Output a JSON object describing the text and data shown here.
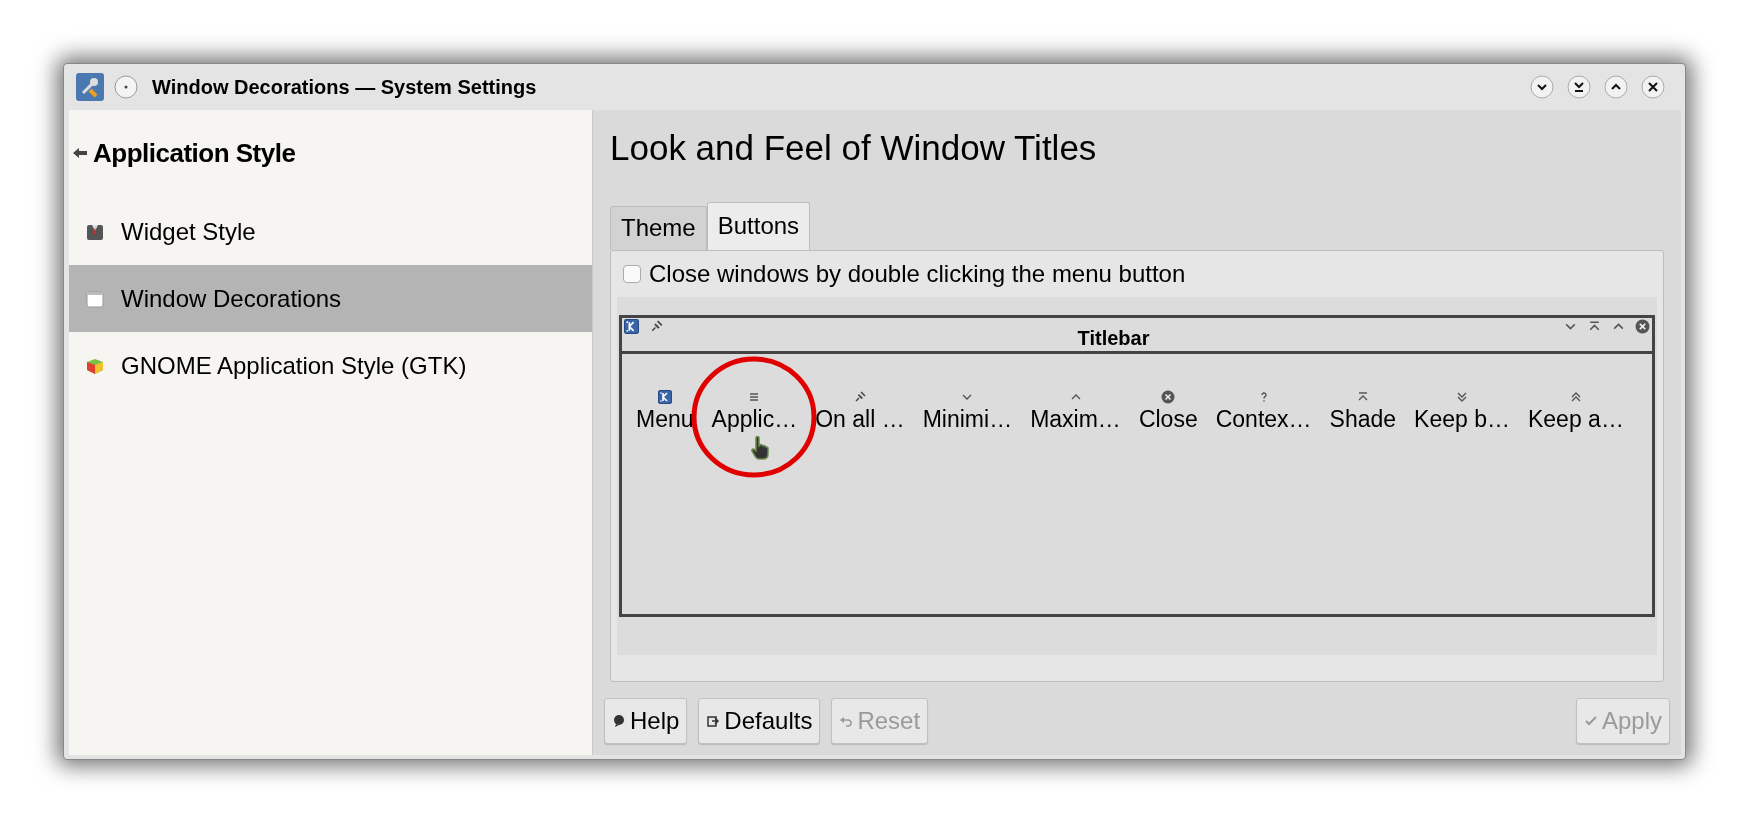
{
  "window": {
    "title": "Window Decorations — System Settings",
    "controls": [
      {
        "kind": "minimize"
      },
      {
        "kind": "shade"
      },
      {
        "kind": "maximize"
      },
      {
        "kind": "close"
      }
    ]
  },
  "sidebar": {
    "heading": "Application Style",
    "items": [
      {
        "kind": "widget_style",
        "label": "Widget Style",
        "selected": false
      },
      {
        "kind": "window_decorations",
        "label": "Window Decorations",
        "selected": true
      },
      {
        "kind": "gtk",
        "label": "GNOME Application Style (GTK)",
        "selected": false
      }
    ]
  },
  "page_title": "Look and Feel of Window Titles",
  "tabs": [
    {
      "label": "Theme",
      "selected": false
    },
    {
      "label": "Buttons",
      "selected": true
    }
  ],
  "close_on_double_click": {
    "label": "Close windows by double clicking the menu button",
    "checked": false
  },
  "titlebar_preview": {
    "title": "Titlebar",
    "left_buttons": [
      {
        "kind": "menu"
      },
      {
        "kind": "on_all_desktops"
      }
    ],
    "right_buttons": [
      {
        "kind": "minimize"
      },
      {
        "kind": "shade"
      },
      {
        "kind": "maximize"
      },
      {
        "kind": "close"
      }
    ]
  },
  "available_buttons": [
    {
      "kind": "menu",
      "label": "Menu",
      "highlighted": false
    },
    {
      "kind": "application_menu",
      "label": "Applic…",
      "highlighted": true
    },
    {
      "kind": "on_all_desktops",
      "label": "On all …",
      "highlighted": false
    },
    {
      "kind": "minimize",
      "label": "Minimi…",
      "highlighted": false
    },
    {
      "kind": "maximize",
      "label": "Maxim…",
      "highlighted": false
    },
    {
      "kind": "close",
      "label": "Close",
      "highlighted": false
    },
    {
      "kind": "context_help",
      "label": "Contex…",
      "highlighted": false
    },
    {
      "kind": "shade",
      "label": "Shade",
      "highlighted": false
    },
    {
      "kind": "keep_below",
      "label": "Keep b…",
      "highlighted": false
    },
    {
      "kind": "keep_above",
      "label": "Keep a…",
      "highlighted": false
    }
  ],
  "footer_buttons": [
    {
      "kind": "help",
      "label": "Help",
      "disabled": false
    },
    {
      "kind": "defaults",
      "label": "Defaults",
      "disabled": false
    },
    {
      "kind": "reset",
      "label": "Reset",
      "disabled": true
    },
    {
      "kind": "apply",
      "label": "Apply",
      "disabled": true
    }
  ]
}
